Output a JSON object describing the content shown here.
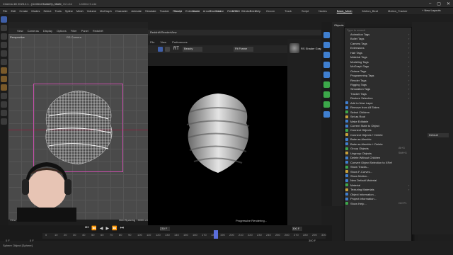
{
  "window": {
    "title": "Cinema 4D 2023.2.1 - [Untitled 5.c4d *] - Main",
    "doc_tabs": [
      "Rotation_Crafti_O2.c4d",
      "Untitled 5.c4d"
    ],
    "controls": [
      "–",
      "▢",
      "✕"
    ]
  },
  "menubar": {
    "items": [
      "File",
      "Edit",
      "Create",
      "Modes",
      "Select",
      "Tools",
      "Spline",
      "Mesh",
      "Volume",
      "MoGraph",
      "Character",
      "Animate",
      "Simulate",
      "Tracker",
      "Render",
      "Extensions",
      "Arnold",
      "Octane",
      "Redshift",
      "Window",
      "Help"
    ],
    "layout_tabs": [
      "Sculpt",
      "Model",
      "Standard",
      "UVEdit",
      "Paint",
      "Groom",
      "Track",
      "Script",
      "Nodes",
      "Basic_Mesh",
      "Motion_Beat",
      "Motion_Tracker"
    ],
    "active_layout": "Basic_Mesh",
    "new_layouts": "+ New Layouts"
  },
  "viewport": {
    "menu": [
      "View",
      "Cameras",
      "Display",
      "Options",
      "Filter",
      "Panel",
      "Redshift"
    ],
    "label": "Perspective",
    "camera": "RS Camera",
    "status": "View Transform: Project",
    "grid_spacing": "Grid Spacing : 5000 cm"
  },
  "render_view": {
    "title": "Redshift RenderView",
    "menu": [
      "File",
      "View",
      "Preferences"
    ],
    "rt_label": "RT",
    "mode": "Beauty",
    "zoom": "Fit Frame",
    "progress": "Progressive Rendering...",
    "snapshot_label": "RS Shader Graph"
  },
  "objects_panel": {
    "title": "Objects"
  },
  "context_menu": {
    "search_placeholder": "Type to search",
    "items": [
      {
        "label": "Animation Tags",
        "arrow": true
      },
      {
        "label": "Bullet Tags",
        "arrow": true
      },
      {
        "label": "Camera Tags",
        "arrow": true
      },
      {
        "label": "Extensions",
        "arrow": true
      },
      {
        "label": "Hair Tags",
        "arrow": true
      },
      {
        "label": "Material Tags",
        "arrow": true
      },
      {
        "label": "Modeling Tags",
        "arrow": true
      },
      {
        "label": "MoGraph Tags",
        "arrow": true
      },
      {
        "label": "Octane Tags",
        "arrow": true
      },
      {
        "label": "Programming Tags",
        "arrow": true
      },
      {
        "label": "Render Tags",
        "arrow": true
      },
      {
        "label": "Rigging Tags",
        "arrow": true
      },
      {
        "label": "Simulation Tags",
        "arrow": true
      },
      {
        "label": "Tracker Tags",
        "arrow": true
      },
      {
        "label": "Restore Selection",
        "arrow": true
      },
      {
        "label": "Add to New Layer",
        "arrow": false
      },
      {
        "label": "Remove from All Takes",
        "arrow": false
      },
      {
        "label": "Select Children",
        "arrow": false
      },
      {
        "label": "Set as Root",
        "arrow": false
      },
      {
        "label": "Make Editable",
        "arrow": false
      },
      {
        "label": "Current State to Object",
        "arrow": false
      },
      {
        "label": "Connect Objects",
        "arrow": false
      },
      {
        "label": "Connect Objects + Delete",
        "arrow": false
      },
      {
        "label": "Bake as Alembic",
        "arrow": false
      },
      {
        "label": "Bake as Alembic + Delete",
        "arrow": false
      },
      {
        "label": "Group Objects",
        "arrow": false,
        "shortcut": "Alt+G"
      },
      {
        "label": "Ungroup Objects",
        "arrow": false,
        "shortcut": "Shift+G"
      },
      {
        "label": "Delete Without Children",
        "arrow": false
      },
      {
        "label": "Convert Object Selection to XRef",
        "arrow": false
      },
      {
        "label": "Show Tracks...",
        "arrow": false
      },
      {
        "label": "Show F-Curves...",
        "arrow": false
      },
      {
        "label": "Show Motion...",
        "arrow": false
      },
      {
        "label": "New Default Material",
        "arrow": false
      },
      {
        "label": "Material",
        "arrow": true
      },
      {
        "label": "Texturing Materials",
        "arrow": true
      },
      {
        "label": "Object Information...",
        "arrow": false
      },
      {
        "label": "Project Information...",
        "arrow": false
      },
      {
        "label": "Show Help...",
        "arrow": false,
        "shortcut": "Ctrl+F1"
      }
    ]
  },
  "right_panel": {
    "default_dropdown": "Default"
  },
  "timeline": {
    "current_frame": "230 F",
    "end_frame": "300 F",
    "start_frame": "0 F",
    "start_frame_2": "0 F",
    "total": "300 F",
    "ticks": [
      "0",
      "10",
      "20",
      "30",
      "40",
      "50",
      "60",
      "70",
      "80",
      "90",
      "100",
      "110",
      "120",
      "130",
      "140",
      "150",
      "160",
      "170",
      "180",
      "190",
      "200",
      "210",
      "220",
      "230",
      "240",
      "250",
      "260",
      "270",
      "280",
      "290",
      "300"
    ],
    "transport": [
      "⏮",
      "⏪",
      "◀",
      "▶",
      "⏩",
      "⏭"
    ]
  },
  "status": {
    "text": "Sphere Object [Sphere]"
  },
  "colors": {
    "accent": "#5a6edb",
    "selection_box": "#c64fa9",
    "menu_bg": "#2d2d2d"
  }
}
